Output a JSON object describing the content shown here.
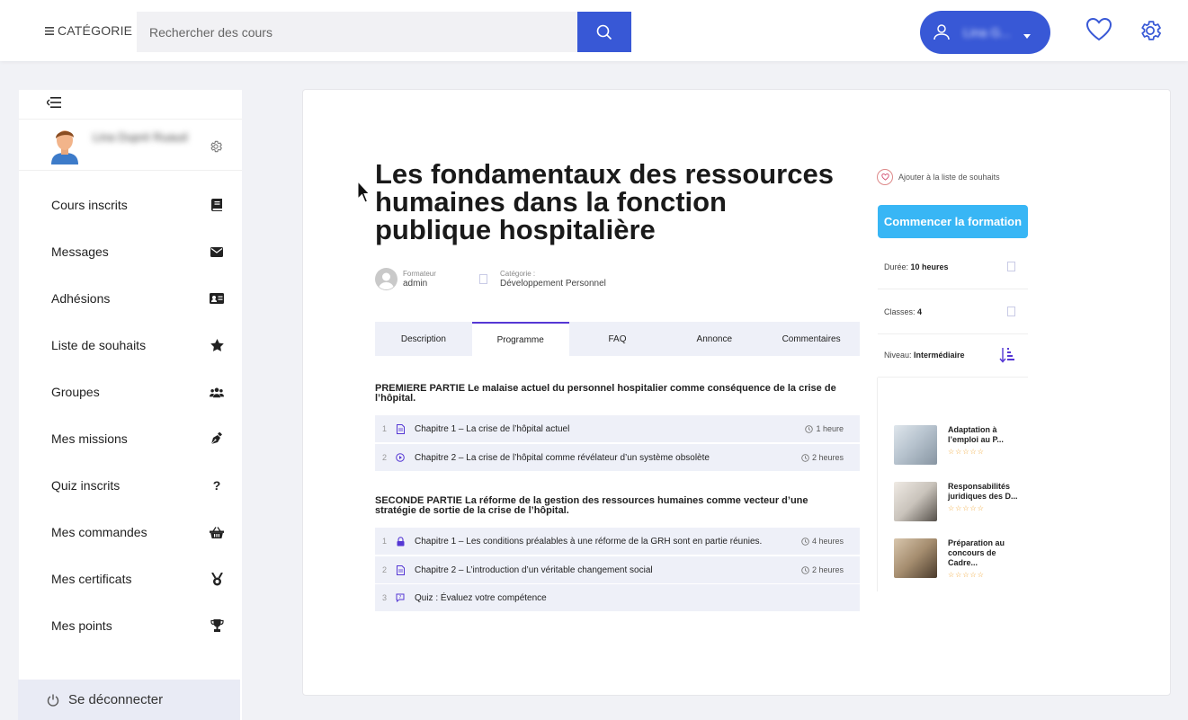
{
  "header": {
    "category_label": "CATÉGORIE",
    "search_placeholder": "Rechercher des cours",
    "user_name": "Lina G..."
  },
  "sidebar": {
    "profile_name": "Lina Dupré Ruaud",
    "items": [
      {
        "label": "Cours inscrits",
        "icon": "book-icon"
      },
      {
        "label": "Messages",
        "icon": "envelope-icon"
      },
      {
        "label": "Adhésions",
        "icon": "id-card-icon"
      },
      {
        "label": "Liste de souhaits",
        "icon": "star-icon"
      },
      {
        "label": "Groupes",
        "icon": "users-icon"
      },
      {
        "label": "Mes missions",
        "icon": "pen-nib-icon"
      },
      {
        "label": "Quiz inscrits",
        "icon": "question-icon"
      },
      {
        "label": "Mes commandes",
        "icon": "basket-icon"
      },
      {
        "label": "Mes certificats",
        "icon": "medal-icon"
      },
      {
        "label": "Mes points",
        "icon": "trophy-icon"
      }
    ],
    "logout_label": "Se déconnecter"
  },
  "course": {
    "title": "Les fondamentaux des ressources humaines dans la fonction publique hospitalière",
    "author_label": "Formateur",
    "author": "admin",
    "category_label": "Catégorie :",
    "category": "Développement Personnel",
    "tabs": [
      "Description",
      "Programme",
      "FAQ",
      "Annonce",
      "Commentaires"
    ],
    "active_tab": "Programme",
    "sections": [
      {
        "title": "PREMIERE PARTIE Le malaise actuel du personnel hospitalier comme conséquence de la crise de l’hôpital.",
        "lessons": [
          {
            "num": "1",
            "title": "Chapitre 1 – La crise de l’hôpital actuel",
            "duration": "1 heure",
            "icon": "document-icon"
          },
          {
            "num": "2",
            "title": "Chapitre 2 – La crise de l’hôpital comme révélateur d’un système obsolète",
            "duration": "2 heures",
            "icon": "play-circle-icon"
          }
        ]
      },
      {
        "title": "SECONDE PARTIE La réforme de la gestion des ressources humaines comme vecteur d’une stratégie de sortie de la crise de l’hôpital.",
        "lessons": [
          {
            "num": "1",
            "title": "Chapitre 1 – Les conditions préalables à une réforme de la GRH sont en partie réunies.",
            "duration": "4 heures",
            "icon": "lock-icon"
          },
          {
            "num": "2",
            "title": "Chapitre 2 – L’introduction d’un véritable changement social",
            "duration": "2 heures",
            "icon": "document-icon"
          },
          {
            "num": "3",
            "title": "Quiz : Évaluez votre compétence",
            "duration": "",
            "icon": "quiz-icon"
          }
        ]
      }
    ]
  },
  "aside": {
    "wishlist_label": "Ajouter à la liste de souhaits",
    "start_label": "Commencer la formation",
    "info": [
      {
        "label": "Durée:",
        "value": "10 heures"
      },
      {
        "label": "Classes:",
        "value": "4"
      },
      {
        "label": "Niveau:",
        "value": "Intermédiaire"
      }
    ],
    "related": [
      {
        "title": "Adaptation à l’emploi au P...",
        "stars": "☆☆☆☆☆",
        "color": "#b8c4cf"
      },
      {
        "title": "Responsabilités juridiques des D...",
        "stars": "☆☆☆☆☆",
        "color": "#c9c3bb"
      },
      {
        "title": "Préparation au concours de Cadre...",
        "stars": "☆☆☆☆☆",
        "color": "#a48c6e"
      }
    ]
  },
  "colors": {
    "accent": "#3858d6",
    "start_button": "#38b6f5",
    "tab_active": "#5537d4",
    "star": "#f0a32c"
  }
}
